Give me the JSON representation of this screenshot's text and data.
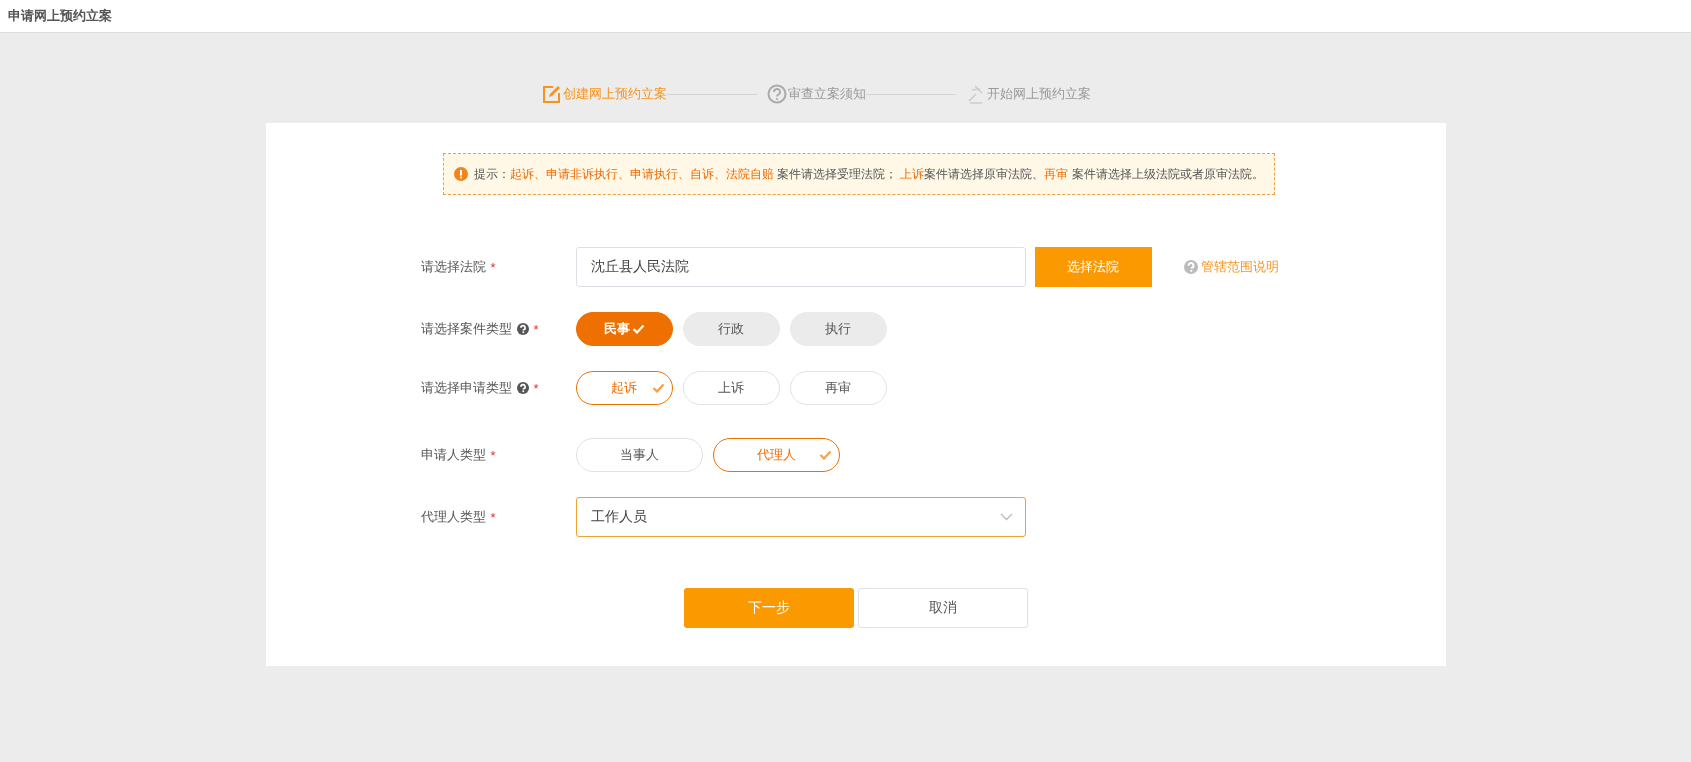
{
  "header": {
    "title": "申请网上预约立案"
  },
  "steps": [
    {
      "label": "创建网上预约立案",
      "kind": "edit",
      "current": true
    },
    {
      "label": "审查立案须知",
      "kind": "question",
      "current": false
    },
    {
      "label": "开始网上预约立案",
      "kind": "gavel",
      "current": false
    }
  ],
  "notice": {
    "segments": [
      {
        "text": "提示：",
        "highlight": false
      },
      {
        "text": "起诉、申请非诉执行、申请执行、自诉、法院自赔",
        "highlight": true
      },
      {
        "text": " 案件请选择受理法院； ",
        "highlight": false
      },
      {
        "text": "上诉",
        "highlight": true
      },
      {
        "text": "案件请选择原审法院、",
        "highlight": false
      },
      {
        "text": "再审",
        "highlight": true
      },
      {
        "text": " 案件请选择上级法院或者原审法院。",
        "highlight": false
      }
    ]
  },
  "form": [
    {
      "kind": "court",
      "label": "请选择法院",
      "required_mark": "*",
      "has_help": false,
      "value": "沈丘县人民法院",
      "button": "选择法院",
      "link": "管辖范围说明"
    },
    {
      "kind": "solid-choice",
      "label": "请选择案件类型",
      "required_mark": "*",
      "has_help": true,
      "options": [
        {
          "label": "民事",
          "selected": true
        },
        {
          "label": "行政",
          "selected": false
        },
        {
          "label": "执行",
          "selected": false
        }
      ]
    },
    {
      "kind": "outline-choice",
      "label": "请选择申请类型",
      "required_mark": "*",
      "has_help": true,
      "options": [
        {
          "label": "起诉",
          "selected": true
        },
        {
          "label": "上诉",
          "selected": false
        },
        {
          "label": "再审",
          "selected": false
        }
      ]
    },
    {
      "kind": "outline-choice",
      "label": "申请人类型",
      "required_mark": "*",
      "has_help": false,
      "options": [
        {
          "label": "当事人",
          "selected": false
        },
        {
          "label": "代理人",
          "selected": true
        }
      ]
    },
    {
      "kind": "select",
      "label": "代理人类型",
      "required_mark": "*",
      "has_help": false,
      "value": "工作人员"
    }
  ],
  "actions": {
    "next": "下一步",
    "cancel": "取消"
  }
}
